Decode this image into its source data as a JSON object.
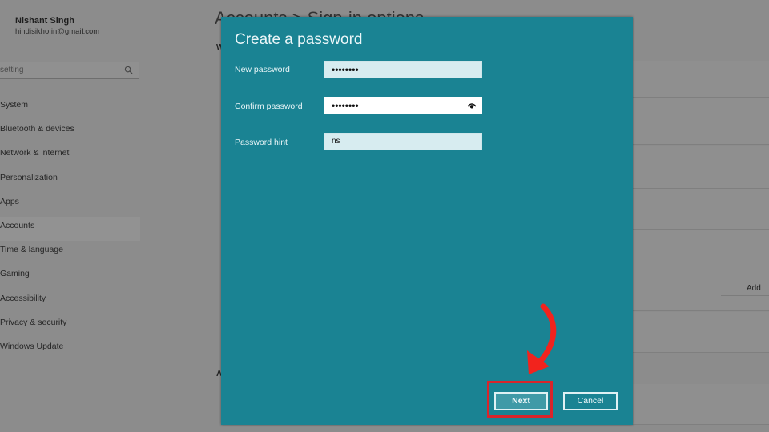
{
  "background": {
    "profile": {
      "name": "Nishant Singh",
      "email": "hindisikho.in@gmail.com"
    },
    "search": {
      "placeholder": "Find a setting",
      "visible_text": "setting",
      "icon": "search-icon"
    },
    "nav": {
      "items": [
        {
          "label": "System"
        },
        {
          "label": "Bluetooth & devices"
        },
        {
          "label": "Network & internet"
        },
        {
          "label": "Personalization"
        },
        {
          "label": "Apps"
        },
        {
          "label": "Accounts",
          "active": true
        },
        {
          "label": "Time & language"
        },
        {
          "label": "Gaming"
        },
        {
          "label": "Accessibility"
        },
        {
          "label": "Privacy & security"
        },
        {
          "label": "Windows Update"
        }
      ]
    },
    "page_title": "Accounts > Sign-in options",
    "section_w": "W",
    "section_a": "A",
    "add_button": "Add"
  },
  "dialog": {
    "title": "Create a password",
    "fields": [
      {
        "label": "New password",
        "value": "••••••••",
        "type": "password"
      },
      {
        "label": "Confirm password",
        "value": "••••••••",
        "type": "password",
        "focused": true,
        "reveal_icon": "eye-icon"
      },
      {
        "label": "Password hint",
        "value": "ns",
        "type": "text"
      }
    ],
    "buttons": {
      "next": "Next",
      "cancel": "Cancel"
    }
  },
  "annotation": {
    "color": "#d9252b",
    "target": "Next"
  },
  "colors": {
    "dialog_bg": "#1a8393",
    "overlay_bg": "#8c8c8c",
    "highlight": "#d9252b"
  }
}
